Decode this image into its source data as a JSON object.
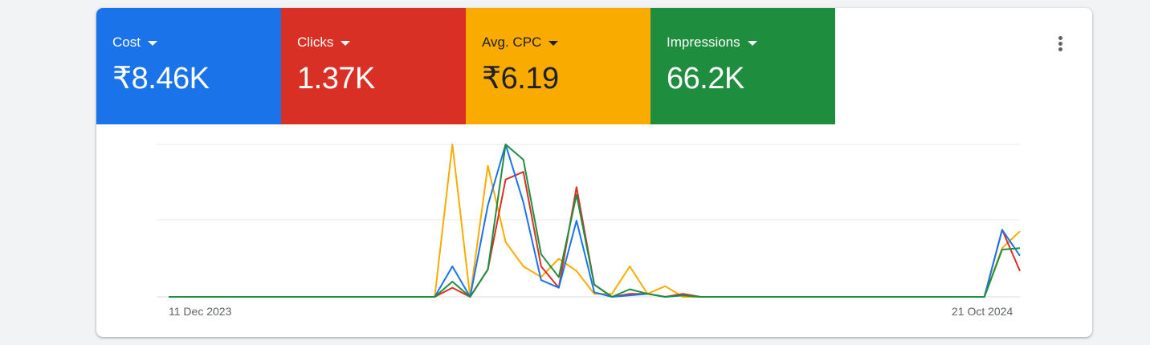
{
  "metrics": [
    {
      "label": "Cost",
      "value": "₹8.46K",
      "color": "#1a73e8"
    },
    {
      "label": "Clicks",
      "value": "1.37K",
      "color": "#d93025"
    },
    {
      "label": "Avg. CPC",
      "value": "₹6.19",
      "color": "#f9ab00"
    },
    {
      "label": "Impressions",
      "value": "66.2K",
      "color": "#1e8e3e"
    }
  ],
  "menu_icon": "more-vert-icon",
  "chart_data": {
    "type": "line",
    "x_first_label": "11 Dec 2023",
    "x_last_label": "21 Oct 2024",
    "normalized": true,
    "ylim": [
      0,
      1
    ],
    "grid": true,
    "series": [
      {
        "color": "#f9ab00",
        "values": [
          0,
          0,
          0,
          0,
          0,
          0,
          0,
          0,
          0,
          0,
          0,
          0,
          0,
          0,
          0,
          0,
          1,
          0,
          0.86,
          0.36,
          0.2,
          0.13,
          0.25,
          0.17,
          0.02,
          0.02,
          0.2,
          0.02,
          0.07,
          0,
          0,
          0,
          0,
          0,
          0,
          0,
          0,
          0,
          0,
          0,
          0,
          0,
          0,
          0,
          0,
          0,
          0,
          0.32,
          0.43
        ]
      },
      {
        "color": "#d93025",
        "values": [
          0,
          0,
          0,
          0,
          0,
          0,
          0,
          0,
          0,
          0,
          0,
          0,
          0,
          0,
          0,
          0,
          0.06,
          0,
          0.18,
          0.77,
          0.82,
          0.2,
          0.06,
          0.72,
          0.08,
          0,
          0.02,
          0.02,
          0,
          0.02,
          0,
          0,
          0,
          0,
          0,
          0,
          0,
          0,
          0,
          0,
          0,
          0,
          0,
          0,
          0,
          0,
          0,
          0.44,
          0.17
        ]
      },
      {
        "color": "#1a73e8",
        "values": [
          0,
          0,
          0,
          0,
          0,
          0,
          0,
          0,
          0,
          0,
          0,
          0,
          0,
          0,
          0,
          0,
          0.2,
          0,
          0.6,
          1,
          0.62,
          0.11,
          0.06,
          0.5,
          0.03,
          0,
          0.01,
          0.02,
          0,
          0.01,
          0,
          0,
          0,
          0,
          0,
          0,
          0,
          0,
          0,
          0,
          0,
          0,
          0,
          0,
          0,
          0,
          0,
          0.44,
          0.27
        ]
      },
      {
        "color": "#1e8e3e",
        "values": [
          0,
          0,
          0,
          0,
          0,
          0,
          0,
          0,
          0,
          0,
          0,
          0,
          0,
          0,
          0,
          0,
          0.1,
          0,
          0.18,
          1,
          0.9,
          0.28,
          0.13,
          0.67,
          0.08,
          0,
          0.05,
          0.02,
          0,
          0.01,
          0,
          0,
          0,
          0,
          0,
          0,
          0,
          0,
          0,
          0,
          0,
          0,
          0,
          0,
          0,
          0,
          0,
          0.31,
          0.32
        ]
      }
    ]
  }
}
